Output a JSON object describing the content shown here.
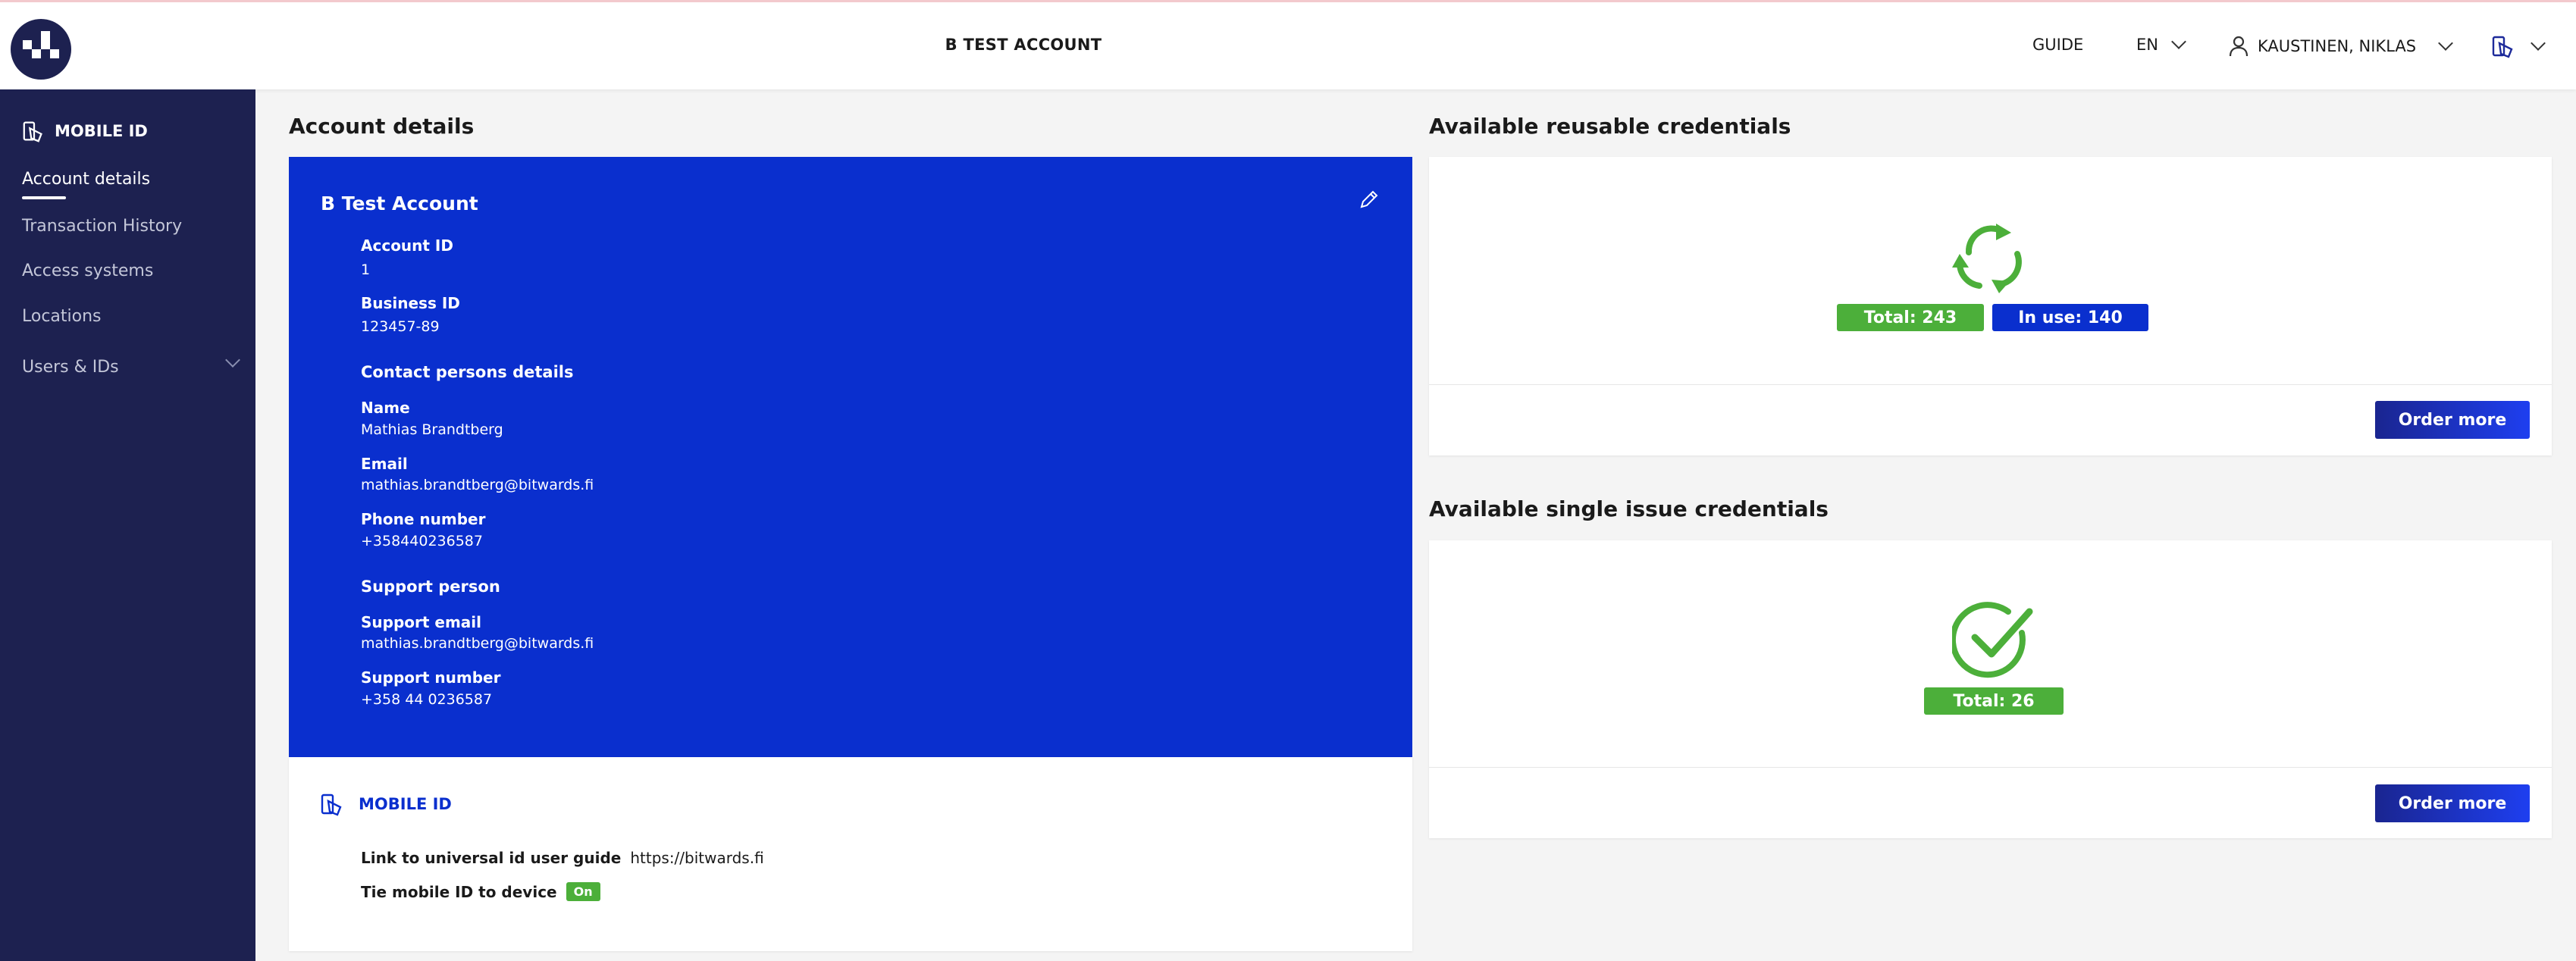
{
  "header": {
    "account_title": "B TEST ACCOUNT",
    "guide_label": "GUIDE",
    "language": "EN",
    "user_name": "KAUSTINEN, NIKLAS"
  },
  "sidebar": {
    "section_label": "MOBILE ID",
    "items": [
      {
        "label": "Account details",
        "active": true
      },
      {
        "label": "Transaction History",
        "active": false
      },
      {
        "label": "Access systems",
        "active": false
      },
      {
        "label": "Locations",
        "active": false
      },
      {
        "label": "Users & IDs",
        "active": false
      }
    ]
  },
  "account_details": {
    "section_title": "Account details",
    "card_title": "B Test Account",
    "account_id_label": "Account ID",
    "account_id": "1",
    "business_id_label": "Business ID",
    "business_id": "123457-89",
    "contact_heading": "Contact persons details",
    "name_label": "Name",
    "name": "Mathias Brandtberg",
    "email_label": "Email",
    "email": "mathias.brandtberg@bitwards.fi",
    "phone_label": "Phone number",
    "phone": "+358440236587",
    "support_heading": "Support person",
    "support_email_label": "Support email",
    "support_email": "mathias.brandtberg@bitwards.fi",
    "support_number_label": "Support number",
    "support_number": "+358 44 0236587"
  },
  "mobile_id": {
    "title": "MOBILE ID",
    "guide_link_label": "Link to universal id user guide",
    "guide_link_url": "https://bitwards.fi",
    "tie_label": "Tie mobile ID to device",
    "tie_status": "On"
  },
  "reusable_credentials": {
    "section_title": "Available reusable credentials",
    "total_text": "Total: 243",
    "in_use_text": "In use: 140",
    "order_label": "Order more"
  },
  "single_issue_credentials": {
    "section_title": "Available single issue credentials",
    "total_text": "Total: 26",
    "order_label": "Order more"
  },
  "colors": {
    "sidebar_bg": "#1d2150",
    "primary_blue": "#0a2fce",
    "success_green": "#4caf3a"
  }
}
